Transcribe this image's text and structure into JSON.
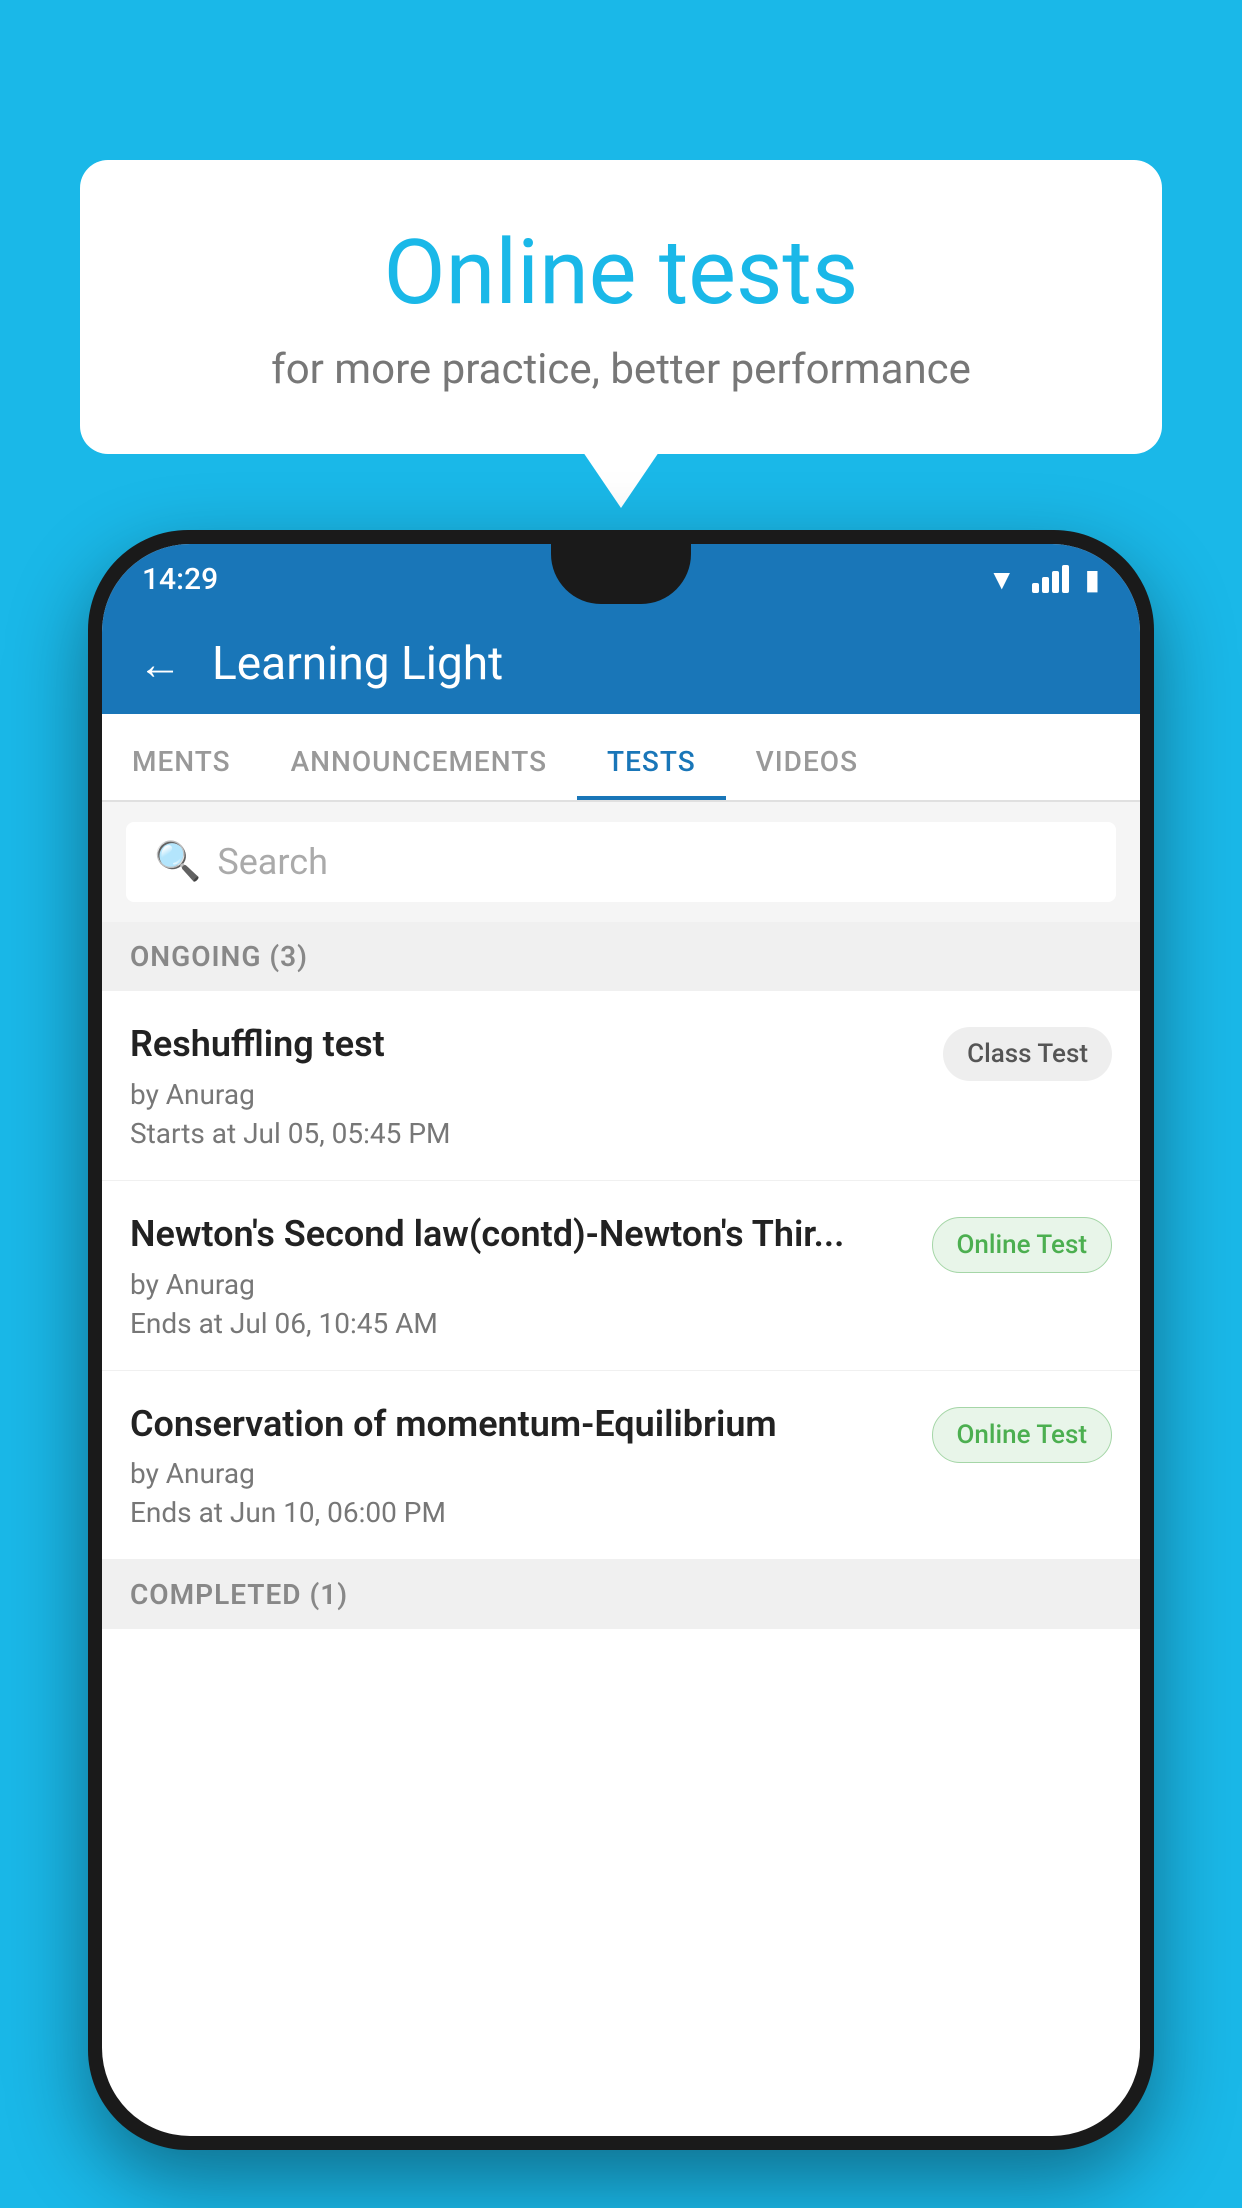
{
  "background_color": "#1ab8e8",
  "speech_bubble": {
    "title": "Online tests",
    "subtitle": "for more practice, better performance"
  },
  "phone": {
    "status_bar": {
      "time": "14:29"
    },
    "app_header": {
      "title": "Learning Light"
    },
    "tabs": [
      {
        "label": "MENTS",
        "active": false
      },
      {
        "label": "ANNOUNCEMENTS",
        "active": false
      },
      {
        "label": "TESTS",
        "active": true
      },
      {
        "label": "VIDEOS",
        "active": false
      }
    ],
    "search": {
      "placeholder": "Search"
    },
    "ongoing_section": {
      "label": "ONGOING (3)"
    },
    "tests": [
      {
        "name": "Reshuffling test",
        "author": "by Anurag",
        "date": "Starts at  Jul 05, 05:45 PM",
        "badge": "Class Test",
        "badge_type": "class"
      },
      {
        "name": "Newton's Second law(contd)-Newton's Thir...",
        "author": "by Anurag",
        "date": "Ends at  Jul 06, 10:45 AM",
        "badge": "Online Test",
        "badge_type": "online"
      },
      {
        "name": "Conservation of momentum-Equilibrium",
        "author": "by Anurag",
        "date": "Ends at  Jun 10, 06:00 PM",
        "badge": "Online Test",
        "badge_type": "online"
      }
    ],
    "completed_section": {
      "label": "COMPLETED (1)"
    }
  }
}
